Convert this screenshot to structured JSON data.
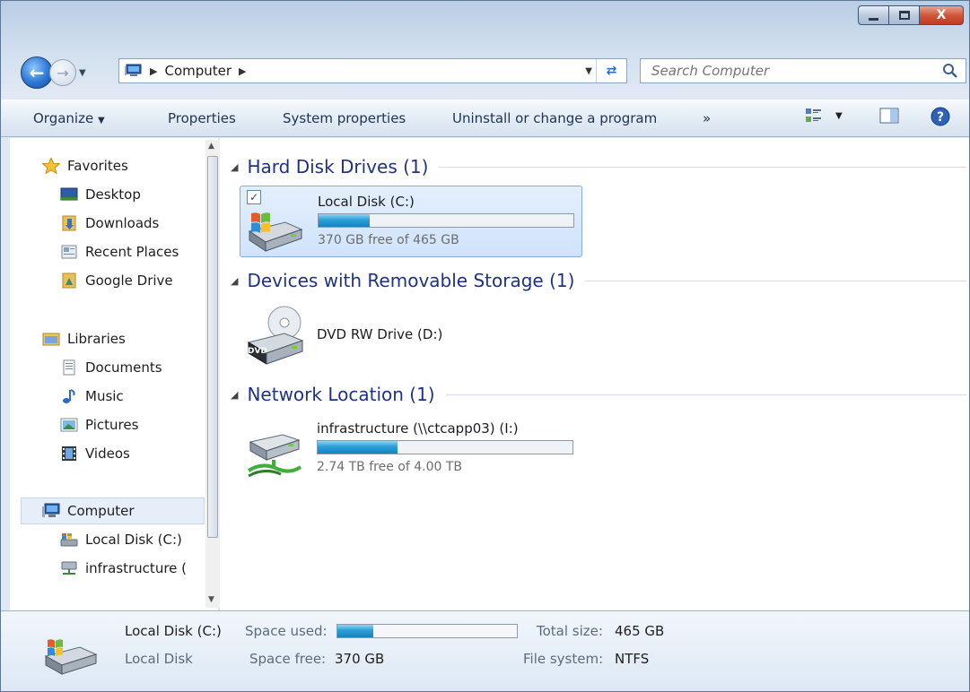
{
  "window": {
    "close_glyph": "X"
  },
  "address": {
    "location": "Computer",
    "search_placeholder": "Search Computer"
  },
  "commands": {
    "organize": "Organize",
    "properties": "Properties",
    "system_properties": "System properties",
    "uninstall": "Uninstall or change a program",
    "more": "»"
  },
  "sidebar": {
    "favorites": "Favorites",
    "favorites_items": [
      "Desktop",
      "Downloads",
      "Recent Places",
      "Google Drive"
    ],
    "libraries": "Libraries",
    "libraries_items": [
      "Documents",
      "Music",
      "Pictures",
      "Videos"
    ],
    "computer": "Computer",
    "computer_items": [
      "Local Disk (C:)",
      "infrastructure ("
    ]
  },
  "groups": {
    "hard_disks": "Hard Disk Drives (1)",
    "removable": "Devices with Removable Storage (1)",
    "network": "Network Location (1)"
  },
  "drives": {
    "c": {
      "name": "Local Disk (C:)",
      "free_text": "370 GB free of 465 GB",
      "used_fraction": 0.2
    },
    "d": {
      "name": "DVD RW Drive (D:)",
      "dvd_label": "DVD"
    },
    "i": {
      "name": "infrastructure (\\\\ctcapp03) (I:)",
      "free_text": "2.74 TB free of 4.00 TB",
      "used_fraction": 0.315
    }
  },
  "details": {
    "name": "Local Disk (C:)",
    "type": "Local Disk",
    "space_used_label": "Space used:",
    "space_used_fraction": 0.2,
    "space_free_label": "Space free:",
    "space_free_value": "370 GB",
    "total_size_label": "Total size:",
    "total_size_value": "465 GB",
    "file_system_label": "File system:",
    "file_system_value": "NTFS"
  },
  "colors": {
    "accent_heading": "#1e3287",
    "bar_fill": "#2aa0d8",
    "selection": "#cfe3fb"
  }
}
